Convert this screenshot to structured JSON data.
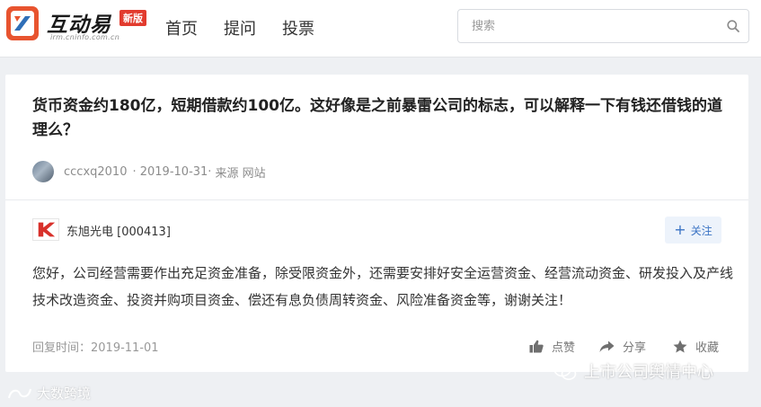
{
  "header": {
    "logo_text": "互动易",
    "logo_badge": "新版",
    "logo_url": "irm.cninfo.com.cn",
    "nav": [
      "首页",
      "提问",
      "投票"
    ],
    "search_placeholder": "搜索"
  },
  "question": {
    "title": "货币资金约180亿，短期借款约100亿。这好像是之前暴雷公司的标志，可以解释一下有钱还借钱的道理么？",
    "author": "cccxq2010",
    "date": "· 2019-10-31·",
    "source": "来源 网站"
  },
  "answer": {
    "company": "东旭光电 [000413]",
    "follow_label": "关注",
    "text": "您好，公司经营需要作出充足资金准备，除受限资金外，还需要安排好安全运营资金、经营流动资金、研发投入及产线技术改造资金、投资并购项目资金、偿还有息负债周转资金、风险准备资金等，谢谢关注！",
    "reply_time": "回复时间：2019-11-01",
    "actions": {
      "like": "点赞",
      "share": "分享",
      "favorite": "收藏"
    }
  },
  "watermarks": {
    "right": "上市公司舆情中心",
    "left": "大数跨境"
  },
  "colors": {
    "accent": "#3a73c4",
    "badge": "#e23b2e",
    "logo_orange": "#e8542f",
    "background": "#eef0f3"
  }
}
